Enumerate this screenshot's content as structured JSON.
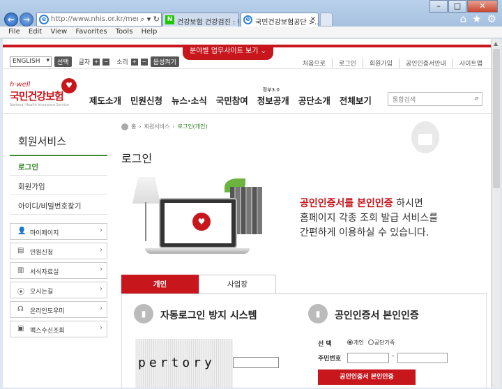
{
  "browser": {
    "address": "http://www.nhis.or.kr/menu/retr",
    "tabs": [
      {
        "label": "건강보험 건강검진 : 네...",
        "favicon": "N"
      },
      {
        "label": "국민건강보험공단 >...",
        "close": "×"
      }
    ],
    "menu": [
      "File",
      "Edit",
      "View",
      "Favorites",
      "Tools",
      "Help"
    ]
  },
  "site": {
    "banner_button": "분야별 업무사이트 보기",
    "language": "ENGLISH",
    "select_button": "선택",
    "font_label": "글자",
    "sound_label": "소리",
    "voice_button": "음성켜기",
    "top_links": [
      "처음으로",
      "로그인",
      "회원가입",
      "공인인증서안내",
      "사이트맵"
    ],
    "logo": {
      "tagline": "h·well",
      "name": "국민건강보험",
      "english": "National Health Insurance Service"
    },
    "gnb": [
      "제도소개",
      "민원신청",
      "뉴스·소식",
      "국민참여",
      "정보공개",
      "공단소개",
      "전체보기"
    ],
    "gnb_sup": "정부3.0",
    "search_placeholder": "통합검색"
  },
  "lnb": {
    "title": "회원서비스",
    "items": [
      "로그인",
      "회원가입",
      "아이디/비밀번호찾기"
    ],
    "quick": [
      "마이페이지",
      "민원신청",
      "서식자료실",
      "오시는길",
      "온라인도우미",
      "팩스수신조회"
    ]
  },
  "content": {
    "breadcrumb": [
      "홈",
      "회원서비스",
      "로그인(개인)"
    ],
    "title": "로그인",
    "pitch": {
      "highlight": "공인인증서를 본인인증",
      "line1_rest": " 하시면",
      "line2": "홈페이지 각종 조회 발급 서비스를",
      "line3": "간편하게 이용하실 수 있습니다."
    },
    "tabs": [
      "개인",
      "사업장"
    ],
    "auto_title": "자동로그인 방지 시스템",
    "captcha": "pertory",
    "cert_title": "공인인증서 본인인증",
    "select_label": "선 택",
    "radio": [
      "개인",
      "공단가족"
    ],
    "jumin_label": "주민번호",
    "cert_button": "공인인증서 본인인증"
  }
}
